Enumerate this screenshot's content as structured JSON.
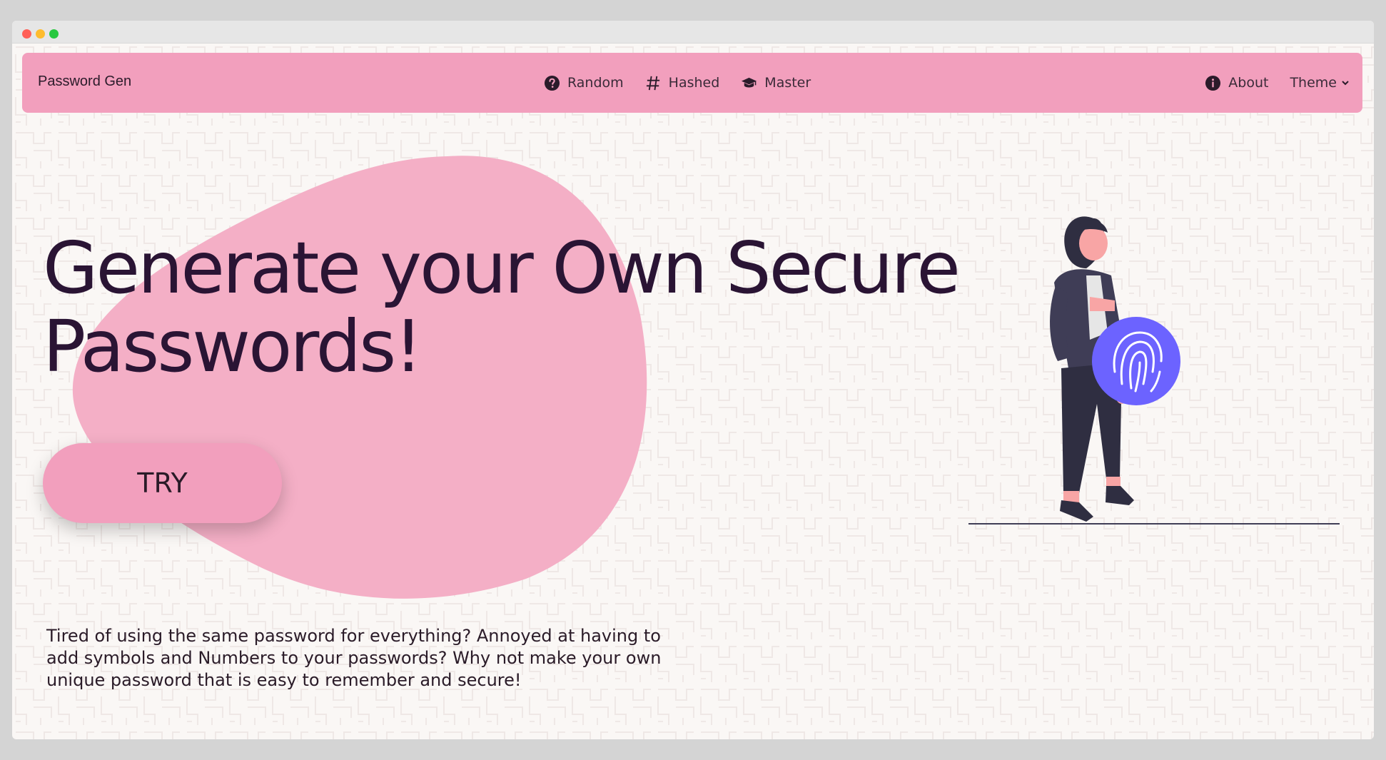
{
  "app": {
    "brand": "Password Gen"
  },
  "nav": {
    "center": [
      {
        "label": "Random",
        "icon": "question-circle-icon"
      },
      {
        "label": "Hashed",
        "icon": "hashtag-icon"
      },
      {
        "label": "Master",
        "icon": "graduation-cap-icon"
      }
    ],
    "right": [
      {
        "label": "About",
        "icon": "info-circle-icon"
      },
      {
        "label": "Theme",
        "icon": "chevron-down-icon"
      }
    ]
  },
  "hero": {
    "headline": "Generate your Own Secure Passwords!",
    "cta_label": "TRY",
    "description": "Tired of using the same password for everything? Annoyed at having to add symbols and Numbers to your passwords? Why not make your own unique password that is easy to remember and secure!"
  },
  "colors": {
    "navbar": "#f29fbd",
    "blob": "#f4afc6",
    "headline": "#2a1434",
    "background": "#faf7f5",
    "fingerprint_circle": "#6c63ff"
  }
}
